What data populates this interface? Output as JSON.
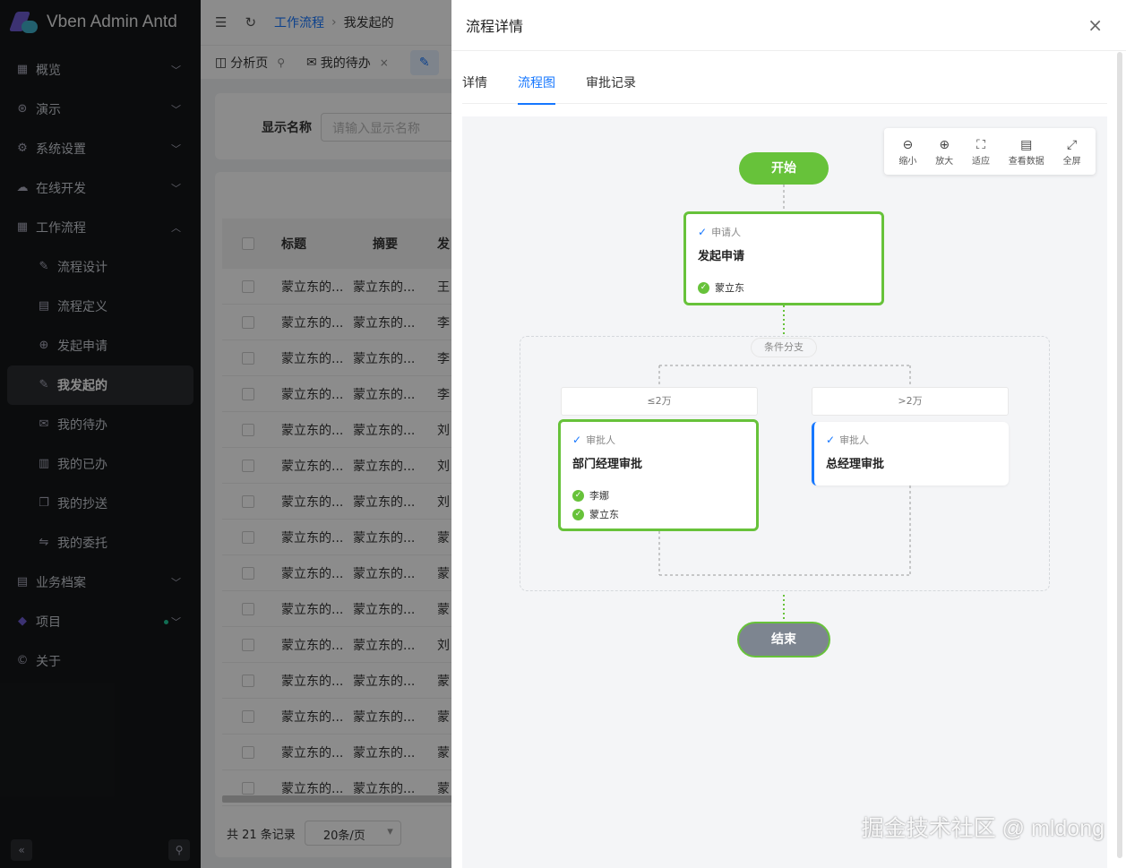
{
  "app": {
    "title": "Vben Admin Antd"
  },
  "sidebar": {
    "items": [
      {
        "label": "概览",
        "icon": "grid-icon"
      },
      {
        "label": "演示",
        "icon": "bug-icon"
      },
      {
        "label": "系统设置",
        "icon": "gear-icon"
      },
      {
        "label": "在线开发",
        "icon": "cloud-icon"
      },
      {
        "label": "工作流程",
        "icon": "flow-icon"
      },
      {
        "label": "项目",
        "icon": "vben-logo-icon"
      },
      {
        "label": "业务档案",
        "icon": "archive-icon"
      },
      {
        "label": "关于",
        "icon": "copyright-icon"
      }
    ],
    "workflow_sub": [
      {
        "label": "流程设计"
      },
      {
        "label": "流程定义"
      },
      {
        "label": "发起申请"
      },
      {
        "label": "我发起的"
      },
      {
        "label": "我的待办"
      },
      {
        "label": "我的已办"
      },
      {
        "label": "我的抄送"
      },
      {
        "label": "我的委托"
      }
    ]
  },
  "header": {
    "crumb1": "工作流程",
    "crumb2": "我发起的"
  },
  "tabs": [
    {
      "label": "分析页"
    },
    {
      "label": "我的待办"
    }
  ],
  "filter": {
    "label": "显示名称",
    "placeholder": "请输入显示名称"
  },
  "table": {
    "headers": [
      "标题",
      "摘要",
      "发"
    ],
    "rows": [
      [
        "蒙立东的...",
        "蒙立东的...",
        "王"
      ],
      [
        "蒙立东的...",
        "蒙立东的...",
        "李"
      ],
      [
        "蒙立东的...",
        "蒙立东的...",
        "李"
      ],
      [
        "蒙立东的...",
        "蒙立东的...",
        "李"
      ],
      [
        "蒙立东的...",
        "蒙立东的...",
        "刘"
      ],
      [
        "蒙立东的...",
        "蒙立东的...",
        "刘"
      ],
      [
        "蒙立东的...",
        "蒙立东的...",
        "刘"
      ],
      [
        "蒙立东的...",
        "蒙立东的...",
        "蒙"
      ],
      [
        "蒙立东的...",
        "蒙立东的...",
        "蒙"
      ],
      [
        "蒙立东的...",
        "蒙立东的...",
        "蒙"
      ],
      [
        "蒙立东的...",
        "蒙立东的...",
        "刘"
      ],
      [
        "蒙立东的...",
        "蒙立东的...",
        "蒙"
      ],
      [
        "蒙立东的...",
        "蒙立东的...",
        "蒙"
      ],
      [
        "蒙立东的...",
        "蒙立东的...",
        "蒙"
      ],
      [
        "蒙立东的...",
        "蒙立东的...",
        "蒙"
      ]
    ]
  },
  "pager": {
    "total": "共 21 条记录",
    "size": "20条/页"
  },
  "drawer": {
    "title": "流程详情",
    "tabs": [
      "详情",
      "流程图",
      "审批记录"
    ],
    "active_tab": "流程图"
  },
  "toolbar": {
    "items": [
      {
        "label": "缩小",
        "icon": "zoom-out-icon"
      },
      {
        "label": "放大",
        "icon": "zoom-in-icon"
      },
      {
        "label": "适应",
        "icon": "fit-icon"
      },
      {
        "label": "查看数据",
        "icon": "document-icon"
      },
      {
        "label": "全屏",
        "icon": "fullscreen-icon"
      }
    ]
  },
  "flow": {
    "start": "开始",
    "end": "结束",
    "applicant": {
      "role": "申请人",
      "title": "发起申请",
      "users": [
        "蒙立东"
      ]
    },
    "condition_label": "条件分支",
    "branches": [
      {
        "condition": "≤2万",
        "role": "审批人",
        "title": "部门经理审批",
        "users": [
          "李娜",
          "蒙立东"
        ]
      },
      {
        "condition": ">2万",
        "role": "审批人",
        "title": "总经理审批",
        "users": []
      }
    ],
    "colors": {
      "done": "#67c23a",
      "pending": "#1677ff",
      "end": "#7d8590"
    }
  },
  "watermark": "掘金技术社区 @ mldong"
}
